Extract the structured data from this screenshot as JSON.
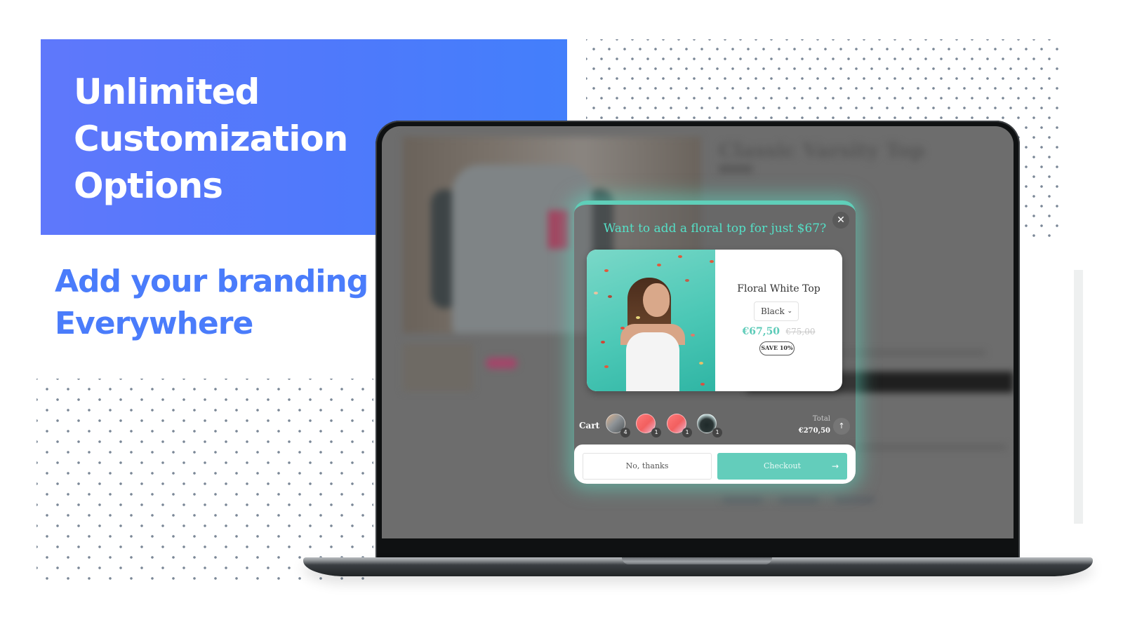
{
  "hero": {
    "title_lines": [
      "Unlimited",
      "Customization",
      "Options"
    ],
    "subtitle_lines": [
      "Add your branding",
      "Everywhere"
    ]
  },
  "colors": {
    "brand_blue": "#4f79fb",
    "subtitle_blue": "#4a7cfb",
    "accent_teal": "#5fcfb9",
    "popup_title_teal": "#54e0c7",
    "dots": "#7a8796"
  },
  "background_page": {
    "product_title": "Classic Varsity Top"
  },
  "popup": {
    "title": "Want to add a floral top for just $67?",
    "close_icon": "close-icon",
    "product": {
      "name": "Floral White Top",
      "variant_selected": "Black",
      "price_sale": "€67,50",
      "price_original": "€75,00",
      "badge": "SAVE 10%"
    },
    "cart": {
      "label": "Cart",
      "items": [
        {
          "name": "varsity-jacket",
          "qty": "4"
        },
        {
          "name": "pink-top",
          "qty": "1"
        },
        {
          "name": "pink-top-2",
          "qty": "1"
        },
        {
          "name": "dark-jacket",
          "qty": "1"
        }
      ],
      "total_label": "Total",
      "total_value": "€270,50",
      "expand_icon": "arrow-up-icon"
    },
    "buttons": {
      "decline": "No, thanks",
      "checkout": "Checkout",
      "checkout_arrow": "→"
    }
  }
}
